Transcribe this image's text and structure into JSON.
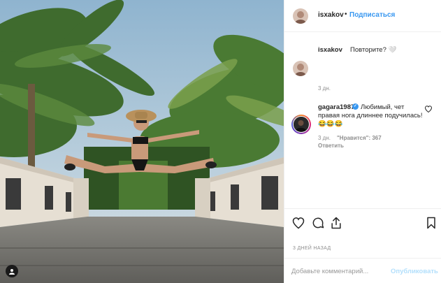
{
  "header": {
    "username": "isxakov",
    "separator": "•",
    "follow_label": "Подписаться"
  },
  "caption": {
    "username": "isxakov",
    "text": "Повторите? 🤍",
    "time": "3 дн."
  },
  "comment": {
    "username": "gagara1987",
    "text_line1": "Любимый, чет",
    "text_line2": "правая нога длиннее подучилась!😂😂😂",
    "time": "3 дн.",
    "likes": "\"Нравится\": 367",
    "reply_label": "Ответить"
  },
  "actions": {
    "like_icon": "heart-icon",
    "comment_icon": "comment-bubble-icon",
    "share_icon": "share-icon",
    "save_icon": "bookmark-icon"
  },
  "posted_ago": "3 ДНЕЙ НАЗАД",
  "comment_box": {
    "placeholder": "Добавьте комментарий...",
    "publish_label": "Опубликовать"
  },
  "colors": {
    "link_blue": "#3897f0",
    "publish_disabled": "#b2dffc",
    "muted": "#8e8e8e",
    "text": "#262626"
  }
}
